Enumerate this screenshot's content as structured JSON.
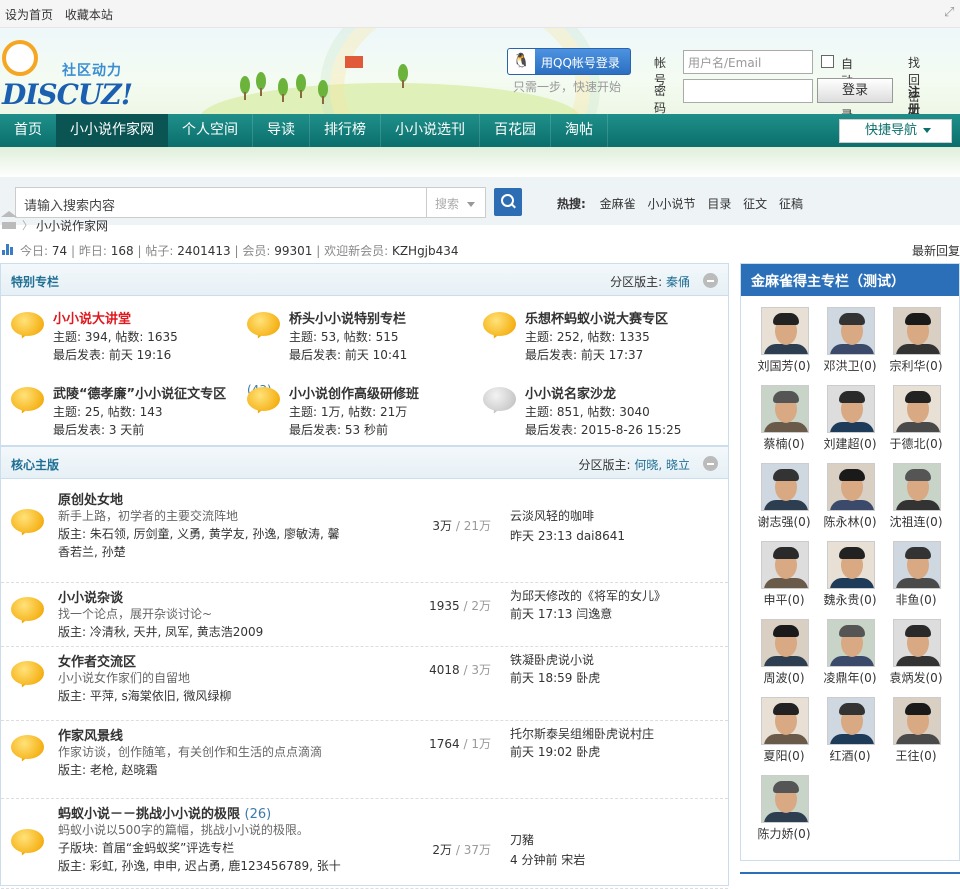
{
  "topbar": {
    "set_home": "设为首页",
    "bookmark": "收藏本站"
  },
  "header": {
    "logo_tagline": "社区动力",
    "logo_word": "DISCUZ!",
    "qq_login": "用QQ帐号登录",
    "qq_tip": "只需一步，快速开始",
    "account_label": "帐号",
    "account_placeholder": "用户名/Email",
    "password_label": "密码",
    "auto_login": "自动登录",
    "find_password": "找回密码",
    "login_button": "登录",
    "register": "注册会员"
  },
  "nav": {
    "items": [
      "首页",
      "小小说作家网",
      "个人空间",
      "导读",
      "排行榜",
      "小小说选刊",
      "百花园",
      "淘帖"
    ],
    "active_index": 1,
    "quick_nav": "快捷导航"
  },
  "search": {
    "placeholder": "请输入搜索内容",
    "type": "搜索",
    "hot_label": "热搜:",
    "hot_terms": [
      "金麻雀",
      "小小说节",
      "目录",
      "征文",
      "征稿"
    ]
  },
  "breadcrumb": {
    "current": "小小说作家网"
  },
  "stats": {
    "today_label": "今日:",
    "today": "74",
    "yesterday_label": "昨日:",
    "yesterday": "168",
    "posts_label": "帖子:",
    "posts": "2401413",
    "members_label": "会员:",
    "members": "99301",
    "welcome_label": "欢迎新会员:",
    "newest_member": "KZHgjb434",
    "latest_reply": "最新回复"
  },
  "special": {
    "title": "特别专栏",
    "moderator_label": "分区版主:",
    "moderators": "秦俑",
    "forums": [
      {
        "name": "小小说大讲堂",
        "highlight": true,
        "count": "",
        "stats": "主题: 394, 帖数: 1635",
        "last": "最后发表: 前天 19:16",
        "gray": false
      },
      {
        "name": "桥头小小说特别专栏",
        "highlight": false,
        "count": "",
        "stats": "主题: 53, 帖数: 515",
        "last": "最后发表: 前天 10:41",
        "gray": false
      },
      {
        "name": "乐想杯蚂蚁小说大赛专区",
        "highlight": false,
        "count": "",
        "stats": "主题: 252, 帖数: 1335",
        "last": "最后发表: 前天 17:37",
        "gray": false
      },
      {
        "name": "武陵“德孝廉”小小说征文专区",
        "highlight": false,
        "count": "",
        "stats": "主题: 25, 帖数: 143",
        "last": "最后发表: 3 天前",
        "gray": false
      },
      {
        "name": "小小说创作高级研修班",
        "highlight": false,
        "count": "(43)",
        "stats": "主题: 1万, 帖数: 21万",
        "last": "最后发表: 53 秒前",
        "gray": false
      },
      {
        "name": "小小说名家沙龙",
        "highlight": false,
        "count": "",
        "stats": "主题: 851, 帖数: 3040",
        "last": "最后发表: 2015-8-26 15:25",
        "gray": true
      }
    ]
  },
  "core": {
    "title": "核心主版",
    "moderator_label": "分区版主:",
    "moderators": "何晓, 晓立",
    "forums": [
      {
        "name": "原创处女地",
        "count": "",
        "desc": "新手上路，初学者的主要交流阵地",
        "mods": "版主: 朱石领, 厉剑童, 义勇, 黄学友, 孙逸, 廖敏涛, 馨香若兰, 孙楚",
        "threads": "3万",
        "posts": "21万",
        "last_title": "云淡风轻的咖啡",
        "last_info": "昨天 23:13 dai8641"
      },
      {
        "name": "小小说杂谈",
        "count": "",
        "desc": "找一个论点，展开杂谈讨论~",
        "mods": "版主: 冷清秋, 天井, 凤军, 黄志浩2009",
        "threads": "1935",
        "posts": "2万",
        "last_title": "为邱天修改的《将军的女儿》",
        "last_info": "前天 17:13 闫逸意"
      },
      {
        "name": "女作者交流区",
        "count": "",
        "desc": "小小说女作家们的自留地",
        "mods": "版主: 平萍, s海棠依旧, 微风绿柳",
        "threads": "4018",
        "posts": "3万",
        "last_title": "铁凝卧虎说小说",
        "last_info": "前天 18:59 卧虎"
      },
      {
        "name": "作家风景线",
        "count": "",
        "desc": "作家访谈，创作随笔，有关创作和生活的点点滴滴",
        "mods": "版主: 老枪, 赵晓霜",
        "threads": "1764",
        "posts": "1万",
        "last_title": "托尔斯泰吴组缃卧虎说村庄",
        "last_info": "前天 19:02 卧虎"
      },
      {
        "name": "蚂蚁小说－－挑战小小说的极限",
        "count": "(26)",
        "desc": "蚂蚁小说以500字的篇幅，挑战小小说的极限。",
        "sub": "子版块: 首届“金蚂蚁奖”评选专栏",
        "mods": "版主: 彩虹, 孙逸, 申申, 迟占勇, 鹿123456789, 张十",
        "threads": "2万",
        "posts": "37万",
        "last_title": "刀豬",
        "last_info": "4 分钟前 宋岩"
      }
    ]
  },
  "sidebar": {
    "title": "金麻雀得主专栏（测试）",
    "members": [
      {
        "name": "刘国芳(0)"
      },
      {
        "name": "邓洪卫(0)"
      },
      {
        "name": "宗利华(0)"
      },
      {
        "name": "蔡楠(0)"
      },
      {
        "name": "刘建超(0)"
      },
      {
        "name": "于德北(0)"
      },
      {
        "name": "谢志强(0)"
      },
      {
        "name": "陈永林(0)"
      },
      {
        "name": "沈祖连(0)"
      },
      {
        "name": "申平(0)"
      },
      {
        "name": "魏永贵(0)"
      },
      {
        "name": "非鱼(0)"
      },
      {
        "name": "周波(0)"
      },
      {
        "name": "凌鼎年(0)"
      },
      {
        "name": "袁炳发(0)"
      },
      {
        "name": "夏阳(0)"
      },
      {
        "name": "红酒(0)"
      },
      {
        "name": "王往(0)"
      },
      {
        "name": "陈力娇(0)"
      }
    ]
  }
}
